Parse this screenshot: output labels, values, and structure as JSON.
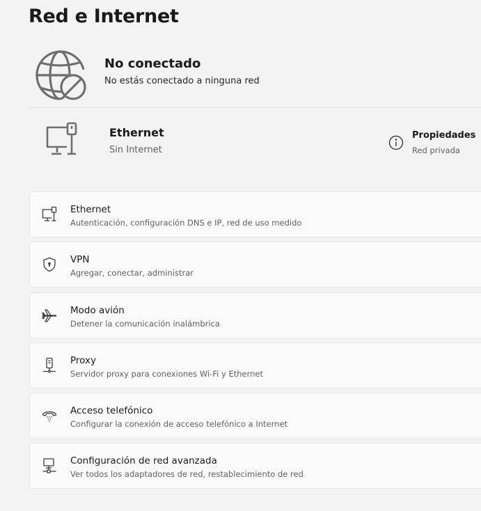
{
  "page": {
    "title": "Red e Internet"
  },
  "status": {
    "title": "No conectado",
    "subtitle": "No estás conectado a ninguna red",
    "icon": "globe-disconnected-icon"
  },
  "ethernet_summary": {
    "title": "Ethernet",
    "subtitle": "Sin Internet",
    "icon": "ethernet-pc-icon",
    "properties": {
      "title": "Propiedades",
      "subtitle": "Red privada",
      "icon": "info-icon"
    }
  },
  "settings": [
    {
      "title": "Ethernet",
      "subtitle": "Autenticación, configuración DNS e IP, red de uso medido",
      "icon": "ethernet-icon"
    },
    {
      "title": "VPN",
      "subtitle": "Agregar, conectar, administrar",
      "icon": "vpn-shield-icon"
    },
    {
      "title": "Modo avión",
      "subtitle": "Detener la comunicación inalámbrica",
      "icon": "airplane-icon"
    },
    {
      "title": "Proxy",
      "subtitle": "Servidor proxy para conexiones Wi-Fi y Ethernet",
      "icon": "proxy-icon"
    },
    {
      "title": "Acceso telefónico",
      "subtitle": "Configurar la conexión de acceso telefónico a Internet",
      "icon": "dial-up-phone-icon"
    },
    {
      "title": "Configuración de red avanzada",
      "subtitle": "Ver todos los adaptadores de red, restablecimiento de red",
      "icon": "advanced-network-icon"
    }
  ]
}
